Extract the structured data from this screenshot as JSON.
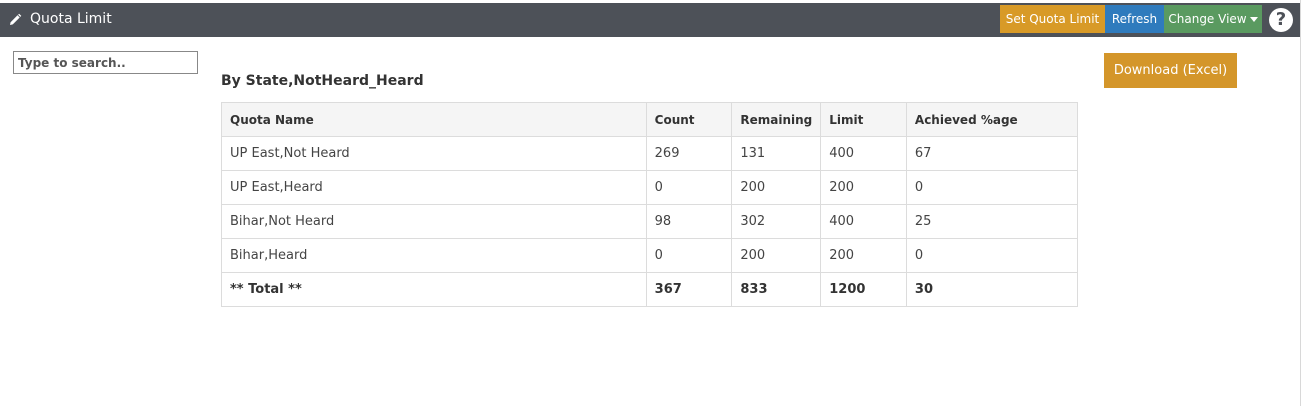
{
  "header": {
    "title": "Quota Limit",
    "buttons": {
      "set_quota": "Set Quota Limit",
      "refresh": "Refresh",
      "change_view": "Change View"
    },
    "help": "?"
  },
  "search": {
    "placeholder": "Type to search..",
    "value": ""
  },
  "download_label": "Download (Excel)",
  "section_title": "By State,NotHeard_Heard",
  "table": {
    "columns": [
      "Quota Name",
      "Count",
      "Remaining",
      "Limit",
      "Achieved %age"
    ],
    "rows": [
      [
        "UP East,Not Heard",
        "269",
        "131",
        "400",
        "67"
      ],
      [
        "UP East,Heard",
        "0",
        "200",
        "200",
        "0"
      ],
      [
        "Bihar,Not Heard",
        "98",
        "302",
        "400",
        "25"
      ],
      [
        "Bihar,Heard",
        "0",
        "200",
        "200",
        "0"
      ]
    ],
    "total": [
      "** Total **",
      "367",
      "833",
      "1200",
      "30"
    ]
  },
  "colors": {
    "titlebar": "#4d5158",
    "set_quota": "#d89a27",
    "refresh": "#2f7bbd",
    "change_view": "#5a9a60",
    "download": "#d4962a"
  },
  "icons": {
    "title": "pencil-icon",
    "help": "help-icon",
    "caret": "caret-down-icon"
  }
}
